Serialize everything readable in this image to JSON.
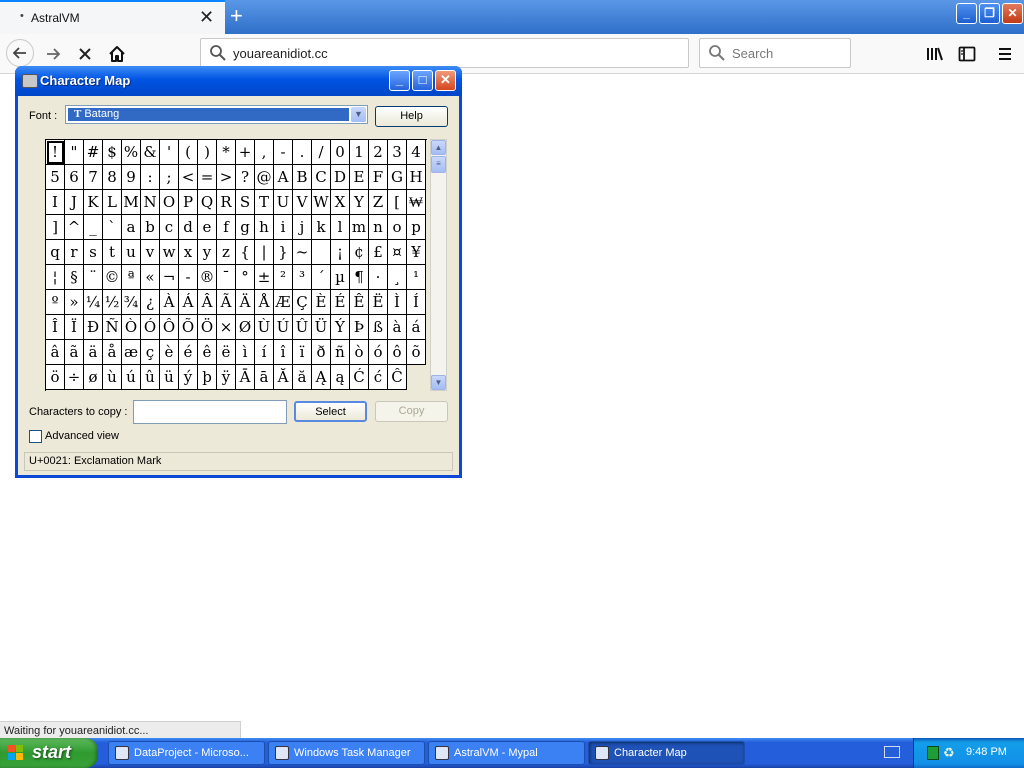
{
  "browser": {
    "tab_title": "AstralVM",
    "tab_dot": "•",
    "tab_close": "✕",
    "new_tab": "+",
    "url": "youareanidiot.cc",
    "search_placeholder": "Search",
    "status": "Waiting for youareanidiot.cc...",
    "window_controls": {
      "minimize": "_",
      "maximize": "❐",
      "close": "✕"
    },
    "accent": "#0a84ff"
  },
  "charmap": {
    "title": "Character Map",
    "font_label": "Font :",
    "font_value": "Batang",
    "font_type_glyph": "T",
    "help_label": "Help",
    "characters": [
      "!",
      "\"",
      "#",
      "$",
      "%",
      "&",
      "'",
      "(",
      ")",
      "*",
      "+",
      ",",
      "-",
      ".",
      "/",
      "0",
      "1",
      "2",
      "3",
      "4",
      "5",
      "6",
      "7",
      "8",
      "9",
      ":",
      ";",
      "<",
      "=",
      ">",
      "?",
      "@",
      "A",
      "B",
      "C",
      "D",
      "E",
      "F",
      "G",
      "H",
      "I",
      "J",
      "K",
      "L",
      "M",
      "N",
      "O",
      "P",
      "Q",
      "R",
      "S",
      "T",
      "U",
      "V",
      "W",
      "X",
      "Y",
      "Z",
      "[",
      "₩",
      "]",
      "^",
      "_",
      "`",
      "a",
      "b",
      "c",
      "d",
      "e",
      "f",
      "g",
      "h",
      "i",
      "j",
      "k",
      "l",
      "m",
      "n",
      "o",
      "p",
      "q",
      "r",
      "s",
      "t",
      "u",
      "v",
      "w",
      "x",
      "y",
      "z",
      "{",
      "|",
      "}",
      "~",
      " ",
      "¡",
      "¢",
      "£",
      "¤",
      "¥",
      "¦",
      "§",
      "¨",
      "©",
      "ª",
      "«",
      "¬",
      "-",
      "®",
      "¯",
      "°",
      "±",
      "²",
      "³",
      "´",
      "µ",
      "¶",
      "·",
      "¸",
      "¹",
      "º",
      "»",
      "¼",
      "½",
      "¾",
      "¿",
      "À",
      "Á",
      "Â",
      "Ã",
      "Ä",
      "Å",
      "Æ",
      "Ç",
      "È",
      "É",
      "Ê",
      "Ë",
      "Ì",
      "Í",
      "Î",
      "Ï",
      "Ð",
      "Ñ",
      "Ò",
      "Ó",
      "Ô",
      "Õ",
      "Ö",
      "×",
      "Ø",
      "Ù",
      "Ú",
      "Û",
      "Ü",
      "Ý",
      "Þ",
      "ß",
      "à",
      "á",
      "â",
      "ã",
      "ä",
      "å",
      "æ",
      "ç",
      "è",
      "é",
      "ê",
      "ë",
      "ì",
      "í",
      "î",
      "ï",
      "ð",
      "ñ",
      "ò",
      "ó",
      "ô",
      "õ",
      "ö",
      "÷",
      "ø",
      "ù",
      "ú",
      "û",
      "ü",
      "ý",
      "þ",
      "ÿ",
      "Ā",
      "ā",
      "Ă",
      "ă",
      "Ą",
      "ą",
      "Ć",
      "ć",
      "Ĉ"
    ],
    "selected_index": 0,
    "copy_label": "Characters to copy :",
    "copy_value": "",
    "select_label": "Select",
    "copy_button_label": "Copy",
    "advanced_label": "Advanced view",
    "advanced_checked": false,
    "status": "U+0021: Exclamation Mark",
    "window_controls": {
      "minimize": "_",
      "maximize": "□",
      "close": "✕"
    }
  },
  "taskbar": {
    "start_label": "start",
    "tasks": [
      {
        "label": "DataProject - Microso...",
        "active": false
      },
      {
        "label": "Windows Task Manager",
        "active": false
      },
      {
        "label": "AstralVM - Mypal",
        "active": false
      },
      {
        "label": "Character Map",
        "active": true
      }
    ],
    "clock": "9:48 PM",
    "tray_glyph": "♻"
  }
}
